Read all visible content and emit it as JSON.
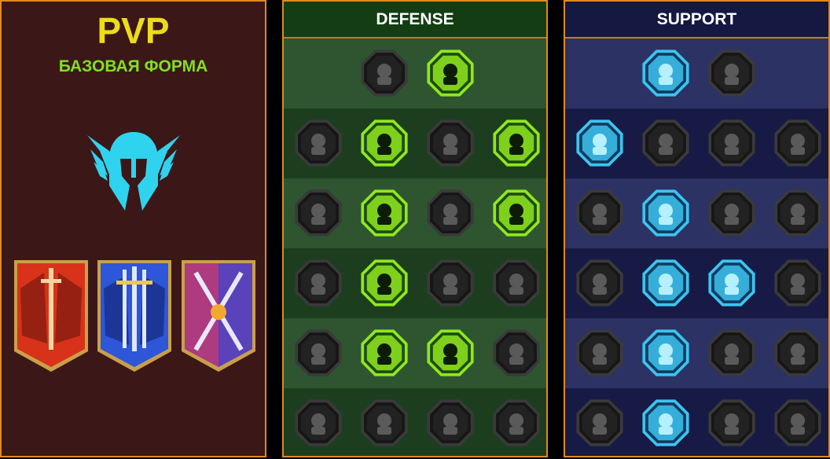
{
  "left_panel": {
    "title": "PVP",
    "subtitle": "БАЗОВАЯ ФОРМА",
    "emblem_icon": "winged-helmet-icon",
    "banners": [
      {
        "icon": "red-banner-swords-icon",
        "color": "#d8321a"
      },
      {
        "icon": "blue-banner-swords-icon",
        "color": "#2d56d8"
      },
      {
        "icon": "purple-banner-swords-icon",
        "color": "#8a3aa8"
      }
    ]
  },
  "defense": {
    "title": "DEFENSE",
    "accent": "#8fe81e",
    "rows": [
      [
        {
          "icon": "stacked-bricks-icon",
          "active": false
        },
        {
          "icon": "raised-fist-icon",
          "active": true
        }
      ],
      [
        {
          "icon": "shield-chevron-icon",
          "active": false
        },
        {
          "icon": "heart-organ-icon",
          "active": true
        },
        {
          "icon": "stone-golem-icon",
          "active": false
        },
        {
          "icon": "crossed-swords-shield-icon",
          "active": true
        }
      ],
      [
        {
          "icon": "dodging-figure-icon",
          "active": false
        },
        {
          "icon": "knight-shield-icon",
          "active": true
        },
        {
          "icon": "heart-skull-icon",
          "active": false
        },
        {
          "icon": "hooded-figure-icon",
          "active": true
        }
      ],
      [
        {
          "icon": "crowd-figures-icon",
          "active": false
        },
        {
          "icon": "hourglass-burst-icon",
          "active": true
        },
        {
          "icon": "open-hand-icon",
          "active": false
        },
        {
          "icon": "bull-head-icon",
          "active": false
        }
      ],
      [
        {
          "icon": "speed-runner-icon",
          "active": false
        },
        {
          "icon": "triple-drops-icon",
          "active": true
        },
        {
          "icon": "radiant-skull-icon",
          "active": true
        },
        {
          "icon": "grasping-hand-icon",
          "active": false
        }
      ],
      [
        {
          "icon": "crowned-warrior-icon",
          "active": false
        },
        {
          "icon": "winged-shield-icon",
          "active": false
        },
        {
          "icon": "bearded-elder-icon",
          "active": false
        },
        {
          "icon": "flexing-strongman-icon",
          "active": false
        }
      ]
    ]
  },
  "support": {
    "title": "SUPPORT",
    "accent": "#3cc4f0",
    "rows": [
      [
        {
          "icon": "heart-plus-icon",
          "active": true
        },
        {
          "icon": "claw-swirl-icon",
          "active": false
        }
      ],
      [
        {
          "icon": "praying-hands-icon",
          "active": true
        },
        {
          "icon": "shield-arcs-icon",
          "active": false
        },
        {
          "icon": "flaming-skull-icon",
          "active": false
        },
        {
          "icon": "arrow-volley-icon",
          "active": false
        }
      ],
      [
        {
          "icon": "blessed-figure-icon",
          "active": false
        },
        {
          "icon": "lightning-shield-icon",
          "active": true
        },
        {
          "icon": "cracked-ground-icon",
          "active": false
        },
        {
          "icon": "shadow-figures-icon",
          "active": false
        }
      ],
      [
        {
          "icon": "chained-heart-icon",
          "active": false
        },
        {
          "icon": "comet-fire-icon",
          "active": true
        },
        {
          "icon": "open-book-icon",
          "active": true
        },
        {
          "icon": "angry-face-icon",
          "active": false
        }
      ],
      [
        {
          "icon": "compass-star-icon",
          "active": false
        },
        {
          "icon": "winged-boot-icon",
          "active": true
        },
        {
          "icon": "watching-eye-icon",
          "active": false
        },
        {
          "icon": "scarecrow-icon",
          "active": false
        }
      ],
      [
        {
          "icon": "poison-flask-icon",
          "active": false
        },
        {
          "icon": "winged-skull-icon",
          "active": true
        },
        {
          "icon": "clenched-fist-icon",
          "active": false
        },
        {
          "icon": "eagle-head-icon",
          "active": false
        }
      ]
    ]
  }
}
